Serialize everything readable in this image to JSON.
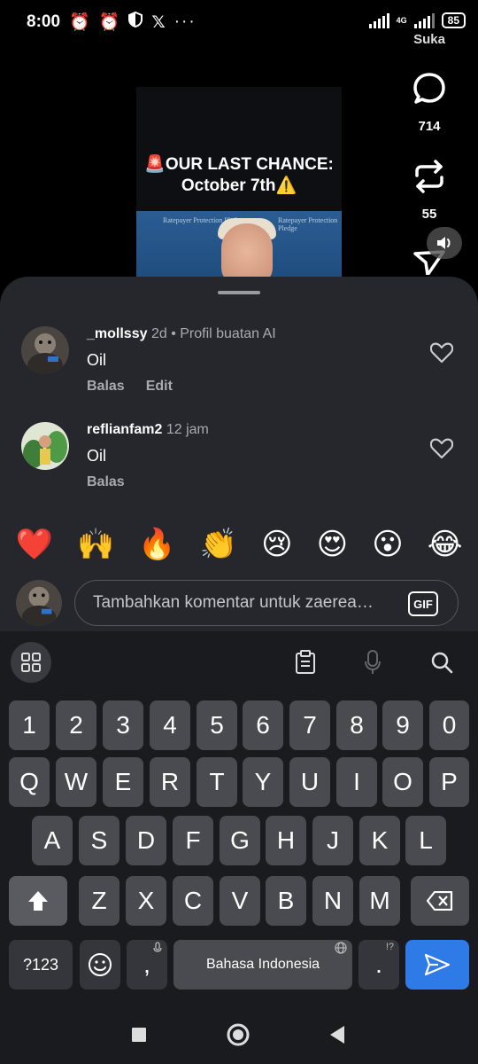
{
  "status_bar": {
    "time": "8:00",
    "network": "4G",
    "battery": "85"
  },
  "video": {
    "title_line1": "🚨OUR LAST CHANCE:",
    "title_line2": "October 7th⚠️",
    "sign_text": "Ratepayer Protection Pledge"
  },
  "side_actions": {
    "likes_label": "Suka",
    "comments_count": "714",
    "reposts_count": "55"
  },
  "comments": [
    {
      "username": "_mollssy",
      "time": "2d",
      "tag": "• Profil buatan AI",
      "text": "Oil",
      "actions": [
        "Balas",
        "Edit"
      ]
    },
    {
      "username": "reflianfam2",
      "time": "12 jam",
      "tag": "",
      "text": "Oil",
      "actions": [
        "Balas"
      ]
    }
  ],
  "emoji_bar": [
    "❤️",
    "🙌",
    "🔥",
    "👏",
    "😢",
    "😍",
    "😮",
    "😂"
  ],
  "input": {
    "placeholder": "Tambahkan komentar untuk zaerea…",
    "gif_label": "GIF"
  },
  "keyboard": {
    "row_numbers": [
      "1",
      "2",
      "3",
      "4",
      "5",
      "6",
      "7",
      "8",
      "9",
      "0"
    ],
    "row_top": [
      "Q",
      "W",
      "E",
      "R",
      "T",
      "Y",
      "U",
      "I",
      "O",
      "P"
    ],
    "row_mid": [
      "A",
      "S",
      "D",
      "F",
      "G",
      "H",
      "J",
      "K",
      "L"
    ],
    "row_bottom": [
      "Z",
      "X",
      "C",
      "V",
      "B",
      "N",
      "M"
    ],
    "symbols_label": "?123",
    "comma_label": ",",
    "space_label": "Bahasa Indonesia",
    "period_label": ".",
    "period_hint": "!?"
  },
  "colors": {
    "sheet_bg": "#26272c",
    "keyboard_bg": "#1a1b1f",
    "key_bg": "#4a4b50",
    "send_key": "#2e7ae6"
  }
}
